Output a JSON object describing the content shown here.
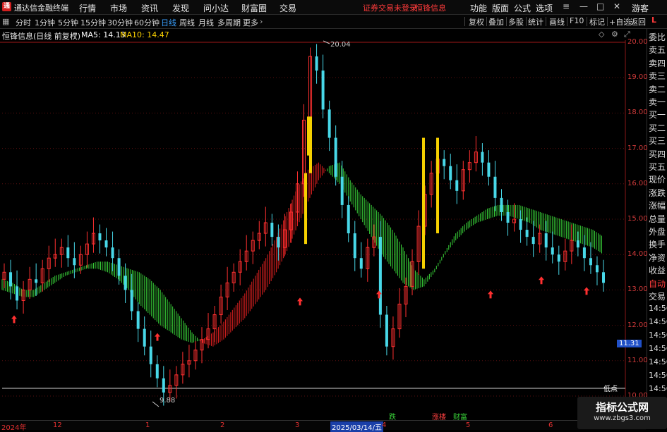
{
  "titlebar": {
    "app_title": "通达信金融终端",
    "menus": [
      "行情",
      "市场",
      "资讯",
      "发现",
      "问小达",
      "财富圈",
      "交易"
    ],
    "warning": "证券交易未登录",
    "stock_name": "恒锋信息",
    "right_menus": [
      "功能",
      "版面",
      "公式",
      "选项"
    ],
    "guest": "游客"
  },
  "toolbar": {
    "periods": [
      "分时",
      "1分钟",
      "5分钟",
      "15分钟",
      "30分钟",
      "60分钟",
      "日线",
      "周线",
      "月线",
      "多周期",
      "更多"
    ],
    "active_period": "日线",
    "buttons": [
      "复权",
      "叠加",
      "多股",
      "统计",
      "画线",
      "F10",
      "标记",
      "+自选",
      "返回"
    ]
  },
  "info": {
    "title": "恒锋信息(日线 前复权)",
    "ma5_label": "MA5: 14.13",
    "ma10_label": "MA10: 14.47",
    "colors": {
      "ma5": "#ffffff",
      "ma10": "#ffd400"
    }
  },
  "sidepanel": {
    "items": [
      "委比",
      "卖五",
      "卖四",
      "卖三",
      "卖二",
      "卖一",
      "买一",
      "买二",
      "买三",
      "买四",
      "买五",
      "现价",
      "涨跌",
      "涨幅",
      "总量",
      "外盘",
      "换手",
      "净资",
      "收益",
      "自动",
      "交易"
    ],
    "times": [
      "14:56",
      "14:56",
      "14:56",
      "14:56",
      "14:56",
      "14:56",
      "14:56",
      "14:56",
      "14:56"
    ],
    "corner_mark": "L"
  },
  "axis": {
    "y_labels": [
      "20.00",
      "19.00",
      "18.00",
      "17.00",
      "16.00",
      "15.00",
      "14.00",
      "13.00",
      "12.00",
      "11.00",
      "10.00"
    ],
    "current_price": "11.31",
    "date_labels": [
      "2024年",
      "12",
      "1",
      "2",
      "3",
      "2025/03/14/五",
      "4",
      "5",
      "6"
    ],
    "annotations": {
      "high": "20.04",
      "low": "9.88",
      "low_marker": "低点"
    },
    "bottom_tags": [
      "跌",
      "涨楼",
      "财富"
    ]
  },
  "watermark": {
    "main": "指标公式网",
    "sub": "www.zbgs3.com"
  },
  "chart_data": {
    "type": "candlestick",
    "title": "恒锋信息(日线 前复权)",
    "ylim": [
      10.0,
      20.0
    ],
    "ma5": 14.13,
    "ma10": 14.47,
    "high": 20.04,
    "low": 9.88,
    "closes": [
      13.5,
      13.1,
      12.7,
      13.0,
      13.3,
      13.2,
      13.6,
      13.9,
      14.0,
      14.2,
      13.9,
      13.7,
      14.0,
      14.3,
      14.6,
      14.4,
      14.2,
      13.9,
      13.4,
      13.0,
      12.4,
      11.9,
      11.4,
      10.9,
      10.5,
      10.1,
      10.3,
      10.6,
      10.9,
      11.0,
      11.3,
      11.6,
      11.9,
      12.3,
      12.8,
      13.2,
      13.5,
      13.8,
      14.1,
      14.4,
      14.6,
      14.9,
      14.5,
      14.2,
      14.7,
      15.2,
      16.0,
      17.8,
      19.6,
      19.2,
      18.1,
      17.3,
      16.2,
      15.4,
      14.6,
      13.9,
      13.6,
      14.2,
      14.5,
      12.3,
      11.4,
      11.9,
      12.6,
      13.1,
      13.8,
      14.8,
      15.7,
      16.3,
      16.7,
      16.5,
      16.1,
      15.8,
      16.4,
      16.6,
      16.9,
      16.6,
      16.2,
      15.6,
      15.2,
      14.9,
      15.0,
      14.7,
      14.5,
      14.3,
      14.6,
      14.2,
      14.0,
      13.8,
      14.1,
      14.4,
      14.2,
      13.9,
      13.7,
      13.5,
      13.2
    ],
    "ma_band_upper": [
      13.3,
      13.2,
      13.0,
      13.0,
      13.2,
      13.4,
      13.5,
      13.6,
      13.7,
      13.8,
      13.8,
      13.7,
      13.6,
      13.5,
      13.3,
      13.0,
      12.6,
      12.2,
      11.8,
      11.5,
      11.4,
      11.6,
      11.9,
      12.2,
      12.6,
      13.0,
      13.5,
      14.1,
      14.8,
      15.5,
      16.1,
      16.5,
      16.6,
      16.1,
      15.7,
      15.4,
      15.1,
      14.7,
      14.2,
      13.6,
      13.3,
      13.6,
      14.1,
      14.6,
      14.9,
      15.1,
      15.3,
      15.4,
      15.4,
      15.4,
      15.3,
      15.2,
      15.1,
      15.0,
      14.9,
      14.8,
      14.7,
      14.5
    ],
    "ma_band_lower": [
      13.0,
      12.9,
      12.8,
      12.8,
      13.0,
      13.2,
      13.4,
      13.5,
      13.6,
      13.6,
      13.5,
      13.3,
      13.0,
      12.6,
      12.3,
      12.0,
      11.8,
      11.6,
      11.5,
      11.6,
      11.8,
      12.1,
      12.5,
      12.9,
      13.4,
      13.9,
      14.5,
      15.2,
      15.9,
      16.4,
      16.6,
      16.3,
      16.0,
      15.5,
      15.0,
      14.5,
      14.0,
      13.6,
      13.2,
      13.0,
      13.1,
      13.5,
      14.0,
      14.4,
      14.7,
      14.9,
      15.0,
      15.1,
      15.1,
      15.0,
      14.9,
      14.7,
      14.6,
      14.5,
      14.4,
      14.3,
      14.2,
      14.0
    ],
    "up_arrows_at_price": [
      12.4,
      11.9,
      12.9,
      13.1,
      13.1,
      13.5,
      13.2
    ],
    "yellow_bars": [
      [
        16.3,
        17.9
      ],
      [
        14.3,
        16.3
      ],
      [
        13.6,
        17.3
      ]
    ]
  }
}
